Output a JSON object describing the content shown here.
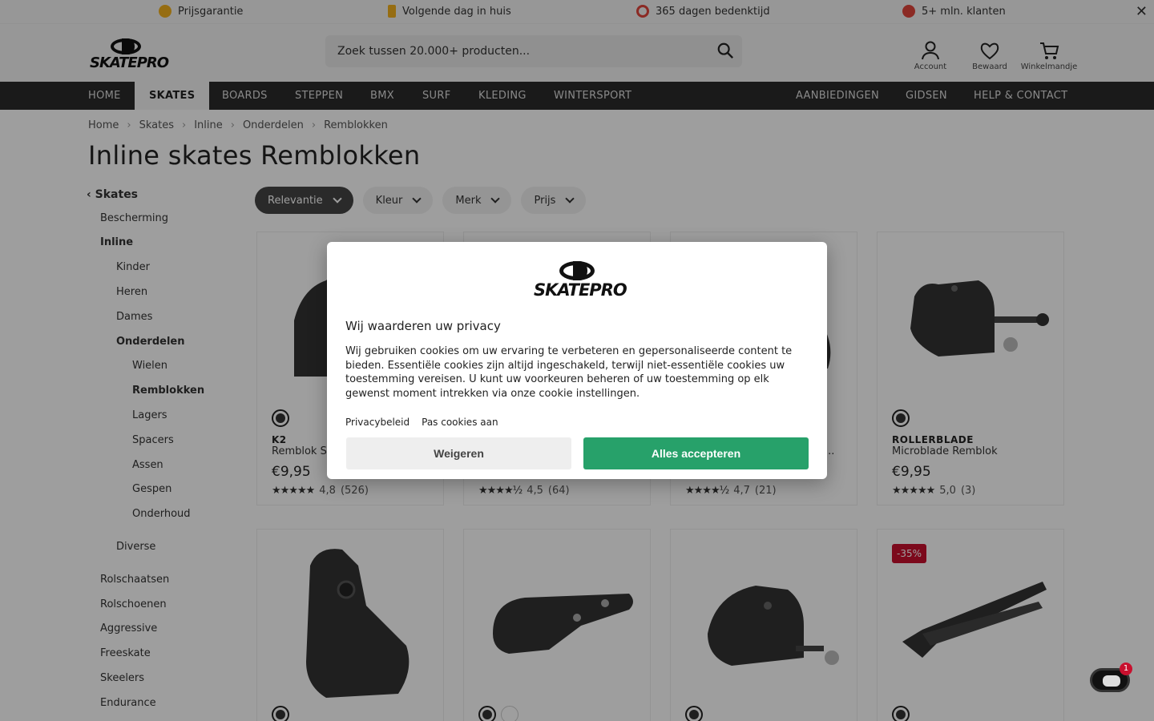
{
  "usp": {
    "items": [
      {
        "label": "Prijsgarantie",
        "icon": "check-badge-icon",
        "color": "#f2b01e"
      },
      {
        "label": "Volgende dag in huis",
        "icon": "bolt-icon",
        "color": "#f2b01e"
      },
      {
        "label": "365 dagen bedenktijd",
        "icon": "cycle-icon",
        "color": "#e0443a"
      },
      {
        "label": "5+ mln. klanten",
        "icon": "people-icon",
        "color": "#e0443a"
      }
    ]
  },
  "header": {
    "logo": "SKATEPRO",
    "search_placeholder": "Zoek tussen 20.000+ producten...",
    "account": "Account",
    "saved": "Bewaard",
    "cart": "Winkelmandje"
  },
  "nav": {
    "left": [
      "HOME",
      "SKATES",
      "BOARDS",
      "STEPPEN",
      "BMX",
      "SURF",
      "KLEDING",
      "WINTERSPORT"
    ],
    "right": [
      "AANBIEDINGEN",
      "GIDSEN",
      "HELP & CONTACT"
    ]
  },
  "breadcrumb": [
    "Home",
    "Skates",
    "Inline",
    "Onderdelen",
    "Remblokken"
  ],
  "page_title": "Inline skates Remblokken",
  "sidebar": {
    "back": "Skates",
    "items": [
      "Bescherming",
      "Inline",
      "Kinder",
      "Heren",
      "Dames",
      "Onderdelen",
      "Wielen",
      "Remblokken",
      "Lagers",
      "Spacers",
      "Assen",
      "Gespen",
      "Onderhoud",
      "Diverse",
      "Rolschaatsen",
      "Rolschoenen",
      "Aggressive",
      "Freeskate",
      "Skeelers",
      "Endurance"
    ]
  },
  "filters": [
    "Relevantie",
    "Kleur",
    "Merk",
    "Prijs"
  ],
  "products": [
    {
      "brand": "K2",
      "name": "Remblok S",
      "price": "€9,95",
      "rating": "4,8",
      "reviews": "(526)"
    },
    {
      "brand": "",
      "name": "",
      "price": "",
      "rating": "4,5",
      "reviews": "(64)"
    },
    {
      "brand": "",
      "name": "...",
      "price": "",
      "rating": "4,7",
      "reviews": "(21)"
    },
    {
      "brand": "ROLLERBLADE",
      "name": "Microblade Remblok",
      "price": "€9,95",
      "rating": "5,0",
      "reviews": "(3)"
    },
    {
      "badge": ""
    },
    {
      "badge": ""
    },
    {
      "badge": ""
    },
    {
      "badge": "-35%"
    }
  ],
  "modal": {
    "logo": "SKATEPRO",
    "title": "Wij waarderen uw privacy",
    "text": "Wij gebruiken cookies om uw ervaring te verbeteren en gepersonaliseerde content te bieden. Essentiële cookies zijn altijd ingeschakeld, terwijl niet-essentiële cookies uw toestemming vereisen. U kunt uw voorkeuren beheren of uw toestemming op elk gewenst moment intrekken via onze cookie instellingen.",
    "link_privacy": "Privacybeleid",
    "link_customize": "Pas cookies aan",
    "reject": "Weigeren",
    "accept": "Alles accepteren"
  },
  "chat": {
    "notifications": "1"
  },
  "colors": {
    "accent_green": "#27a16a",
    "sale_red": "#c8102e",
    "nav_bg": "#2a2a2a"
  }
}
